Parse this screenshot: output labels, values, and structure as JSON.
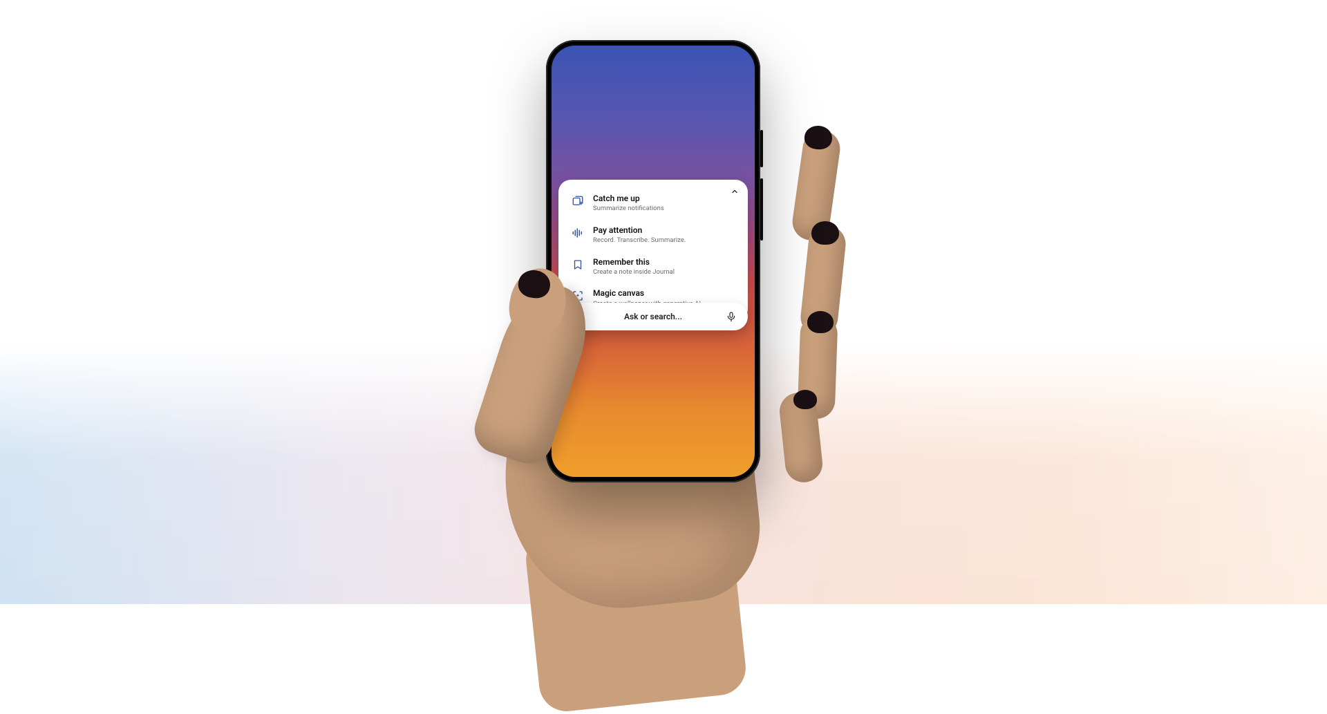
{
  "search": {
    "placeholder": "Ask or search...",
    "left_icon": "sparkle-gear-icon",
    "right_icon": "microphone-icon"
  },
  "panel": {
    "collapse_icon": "chevron-up-icon",
    "actions": [
      {
        "icon": "cards-plus-icon",
        "title": "Catch me up",
        "subtitle": "Summarize notifications"
      },
      {
        "icon": "soundwave-icon",
        "title": "Pay attention",
        "subtitle": "Record. Transcribe. Summarize."
      },
      {
        "icon": "bookmark-icon",
        "title": "Remember this",
        "subtitle": "Create a note inside Journal"
      },
      {
        "icon": "scan-magic-icon",
        "title": "Magic canvas",
        "subtitle": "Create a wallpaper with generative AI"
      }
    ]
  },
  "colors": {
    "icon_primary": "#3551a3",
    "sparkle_accent": "#d24a3a"
  }
}
